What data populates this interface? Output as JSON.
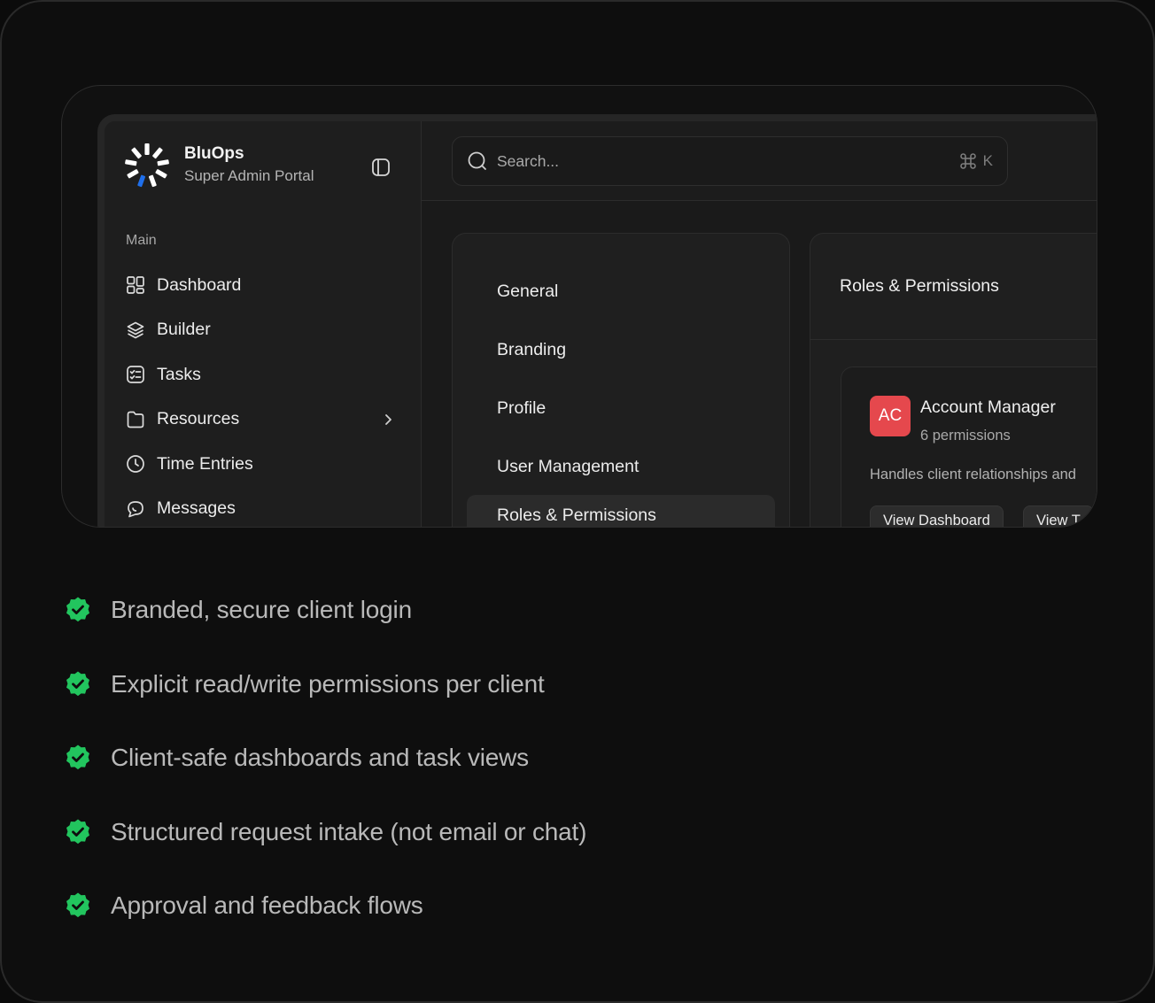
{
  "app": {
    "brand_name": "BluOps",
    "brand_subtitle": "Super Admin Portal",
    "accent_color": "#1f6feb",
    "check_color": "#22c55e"
  },
  "sidebar": {
    "section_label": "Main",
    "items": [
      {
        "label": "Dashboard",
        "icon": "dashboard-grid-icon"
      },
      {
        "label": "Builder",
        "icon": "layers-icon"
      },
      {
        "label": "Tasks",
        "icon": "checklist-icon"
      },
      {
        "label": "Resources",
        "icon": "folder-icon",
        "has_submenu": true
      },
      {
        "label": "Time Entries",
        "icon": "clock-icon"
      },
      {
        "label": "Messages",
        "icon": "chat-icon"
      }
    ]
  },
  "search": {
    "placeholder": "Search...",
    "shortcut_key": "K",
    "shortcut_icon": "command-icon"
  },
  "settings_nav": {
    "items": [
      "General",
      "Branding",
      "Profile",
      "User Management",
      "Roles & Permissions"
    ],
    "active": "Roles & Permissions"
  },
  "roles_panel": {
    "title": "Roles & Permissions",
    "role": {
      "initials": "AC",
      "name": "Account Manager",
      "permissions": "6 permissions",
      "description": "Handles client relationships and",
      "buttons": [
        "View Dashboard",
        "View T"
      ]
    }
  },
  "features": [
    "Branded, secure client login",
    "Explicit read/write permissions per client",
    "Client-safe dashboards and task views",
    "Structured request intake (not email or chat)",
    "Approval and feedback flows"
  ]
}
